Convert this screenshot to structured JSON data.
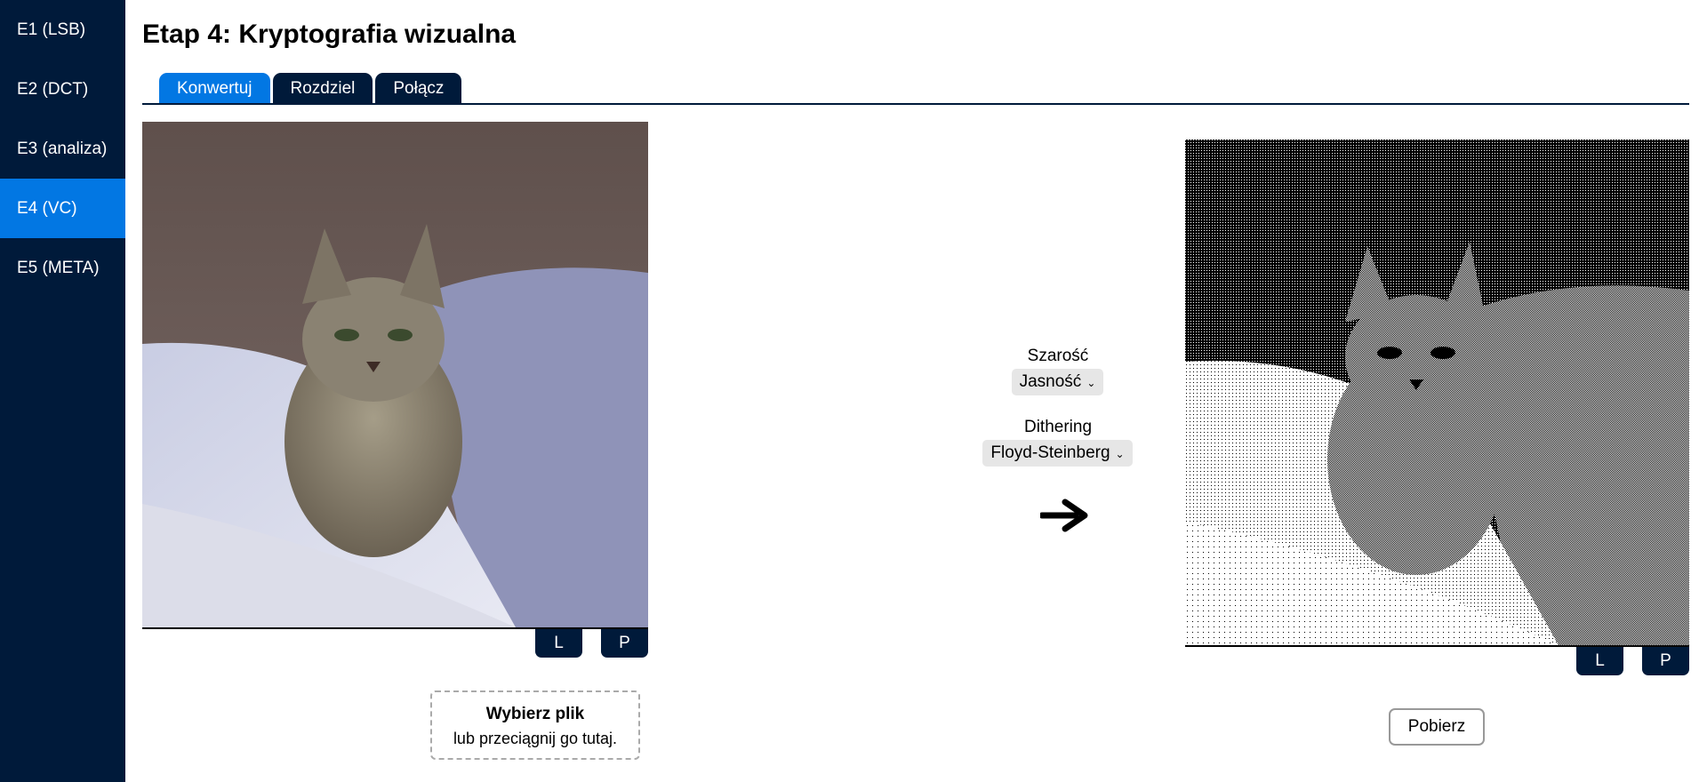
{
  "sidebar": {
    "items": [
      {
        "label": "E1 (LSB)",
        "active": false
      },
      {
        "label": "E2 (DCT)",
        "active": false
      },
      {
        "label": "E3 (analiza)",
        "active": false
      },
      {
        "label": "E4 (VC)",
        "active": true
      },
      {
        "label": "E5 (META)",
        "active": false
      }
    ]
  },
  "page": {
    "title": "Etap 4: Kryptografia wizualna"
  },
  "tabs": [
    {
      "label": "Konwertuj",
      "active": true
    },
    {
      "label": "Rozdziel",
      "active": false
    },
    {
      "label": "Połącz",
      "active": false
    }
  ],
  "left_panel": {
    "l_button": "L",
    "p_button": "P",
    "dropzone_title": "Wybierz plik",
    "dropzone_hint": "lub przeciągnij go tutaj."
  },
  "controls": {
    "grayscale_label": "Szarość",
    "grayscale_value": "Jasność",
    "dithering_label": "Dithering",
    "dithering_value": "Floyd-Steinberg",
    "arrow_icon": "right-arrow-icon"
  },
  "right_panel": {
    "l_button": "L",
    "p_button": "P",
    "download_label": "Pobierz"
  },
  "colors": {
    "sidebar_bg": "#001a3a",
    "accent": "#0277e3"
  }
}
